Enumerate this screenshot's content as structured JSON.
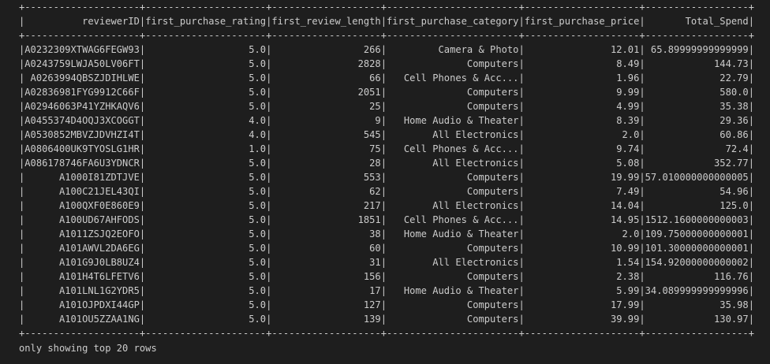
{
  "table": {
    "columns": [
      "reviewerID",
      "first_purchase_rating",
      "first_review_length",
      "first_purchase_category",
      "first_purchase_price",
      "Total_Spend"
    ],
    "rows": [
      [
        "A0232309XTWAG6FEGW93",
        "5.0",
        "266",
        "Camera & Photo",
        "12.01",
        "65.89999999999999"
      ],
      [
        "A0243759LWJA50LV06FT",
        "5.0",
        "2828",
        "Computers",
        "8.49",
        "144.73"
      ],
      [
        "A0263994QBSZJDIHLWE",
        "5.0",
        "66",
        "Cell Phones & Acc...",
        "1.96",
        "22.79"
      ],
      [
        "A02836981FYG9912C66F",
        "5.0",
        "2051",
        "Computers",
        "9.99",
        "580.0"
      ],
      [
        "A02946063P41YZHKAQV6",
        "5.0",
        "25",
        "Computers",
        "4.99",
        "35.38"
      ],
      [
        "A0455374D4OQJ3XCOGGT",
        "4.0",
        "9",
        "Home Audio & Theater",
        "8.39",
        "29.36"
      ],
      [
        "A0530852MBVZJDVHZI4T",
        "4.0",
        "545",
        "All Electronics",
        "2.0",
        "60.86"
      ],
      [
        "A0806400UK9TYOSLG1HR",
        "1.0",
        "75",
        "Cell Phones & Acc...",
        "9.74",
        "72.4"
      ],
      [
        "A086178746FA6U3YDNCR",
        "5.0",
        "28",
        "All Electronics",
        "5.08",
        "352.77"
      ],
      [
        "A1000I81ZDTJVE",
        "5.0",
        "553",
        "Computers",
        "19.99",
        "57.010000000000005"
      ],
      [
        "A100C21JEL43QI",
        "5.0",
        "62",
        "Computers",
        "7.49",
        "54.96"
      ],
      [
        "A100QXF0E860E9",
        "5.0",
        "217",
        "All Electronics",
        "14.04",
        "125.0"
      ],
      [
        "A100UD67AHFODS",
        "5.0",
        "1851",
        "Cell Phones & Acc...",
        "14.95",
        "1512.1600000000003"
      ],
      [
        "A1011ZSJQ2EOFO",
        "5.0",
        "38",
        "Home Audio & Theater",
        "2.0",
        "109.75000000000001"
      ],
      [
        "A101AWVL2DA6EG",
        "5.0",
        "60",
        "Computers",
        "10.99",
        "101.30000000000001"
      ],
      [
        "A101G9J0LB8UZ4",
        "5.0",
        "31",
        "All Electronics",
        "1.54",
        "154.92000000000002"
      ],
      [
        "A101H4T6LFETV6",
        "5.0",
        "156",
        "Computers",
        "2.38",
        "116.76"
      ],
      [
        "A101LNL1G2YDR5",
        "5.0",
        "17",
        "Home Audio & Theater",
        "5.99",
        "34.089999999999996"
      ],
      [
        "A101OJPDXI44GP",
        "5.0",
        "127",
        "Computers",
        "17.99",
        "35.98"
      ],
      [
        "A101OU5ZZAA1NG",
        "5.0",
        "139",
        "Computers",
        "39.99",
        "130.97"
      ]
    ]
  },
  "footer": "only showing top 20 rows",
  "colors": {
    "background": "#1e1e1e",
    "text": "#cccccc"
  }
}
